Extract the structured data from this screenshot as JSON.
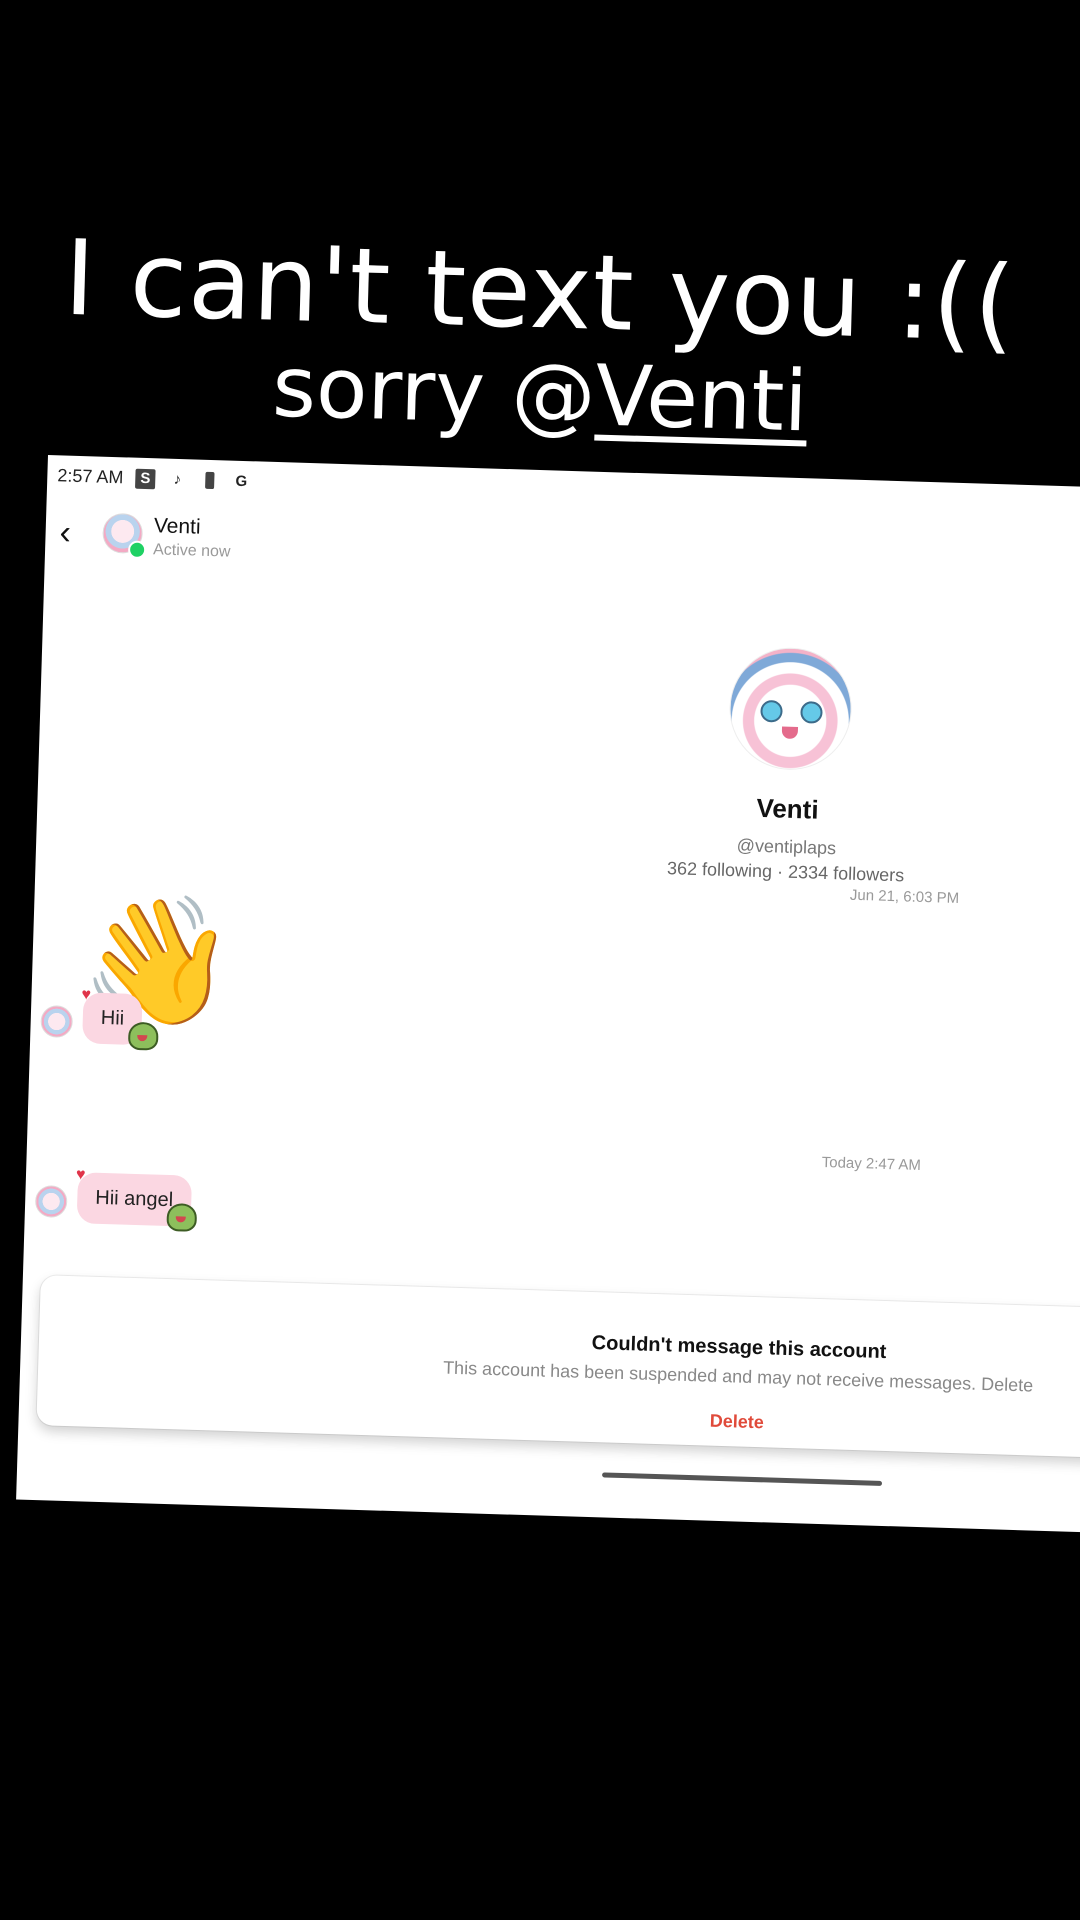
{
  "caption": {
    "line1": "I can't text you :((",
    "line2_prefix": "sorry @",
    "line2_mention": "Venti"
  },
  "statusbar": {
    "time": "2:57 AM",
    "icons": [
      "s-app-icon",
      "tiktok-icon",
      "battery-icon",
      "google-icon"
    ],
    "s_label": "S",
    "g_label": "G",
    "tiktok_glyph": "♪"
  },
  "topbar": {
    "back_glyph": "‹",
    "name": "Venti",
    "status": "Active now"
  },
  "profile": {
    "name": "Venti",
    "handle": "@ventiplaps",
    "stats": "362 following · 2334 followers"
  },
  "messages": {
    "timestamp1": "Jun 21, 6:03 PM",
    "wave_emoji": "👋",
    "msg1": "Hii",
    "timestamp2": "Today 2:47 AM",
    "msg2": "Hii angel",
    "heart": "♥"
  },
  "sheet": {
    "title": "Couldn't message this account",
    "body": "This account has been suspended and may not receive messages. Delete",
    "delete_label": "Delete"
  },
  "colors": {
    "online": "#1fd164",
    "bubble": "#fbd7e2",
    "delete": "#e04a3a"
  }
}
